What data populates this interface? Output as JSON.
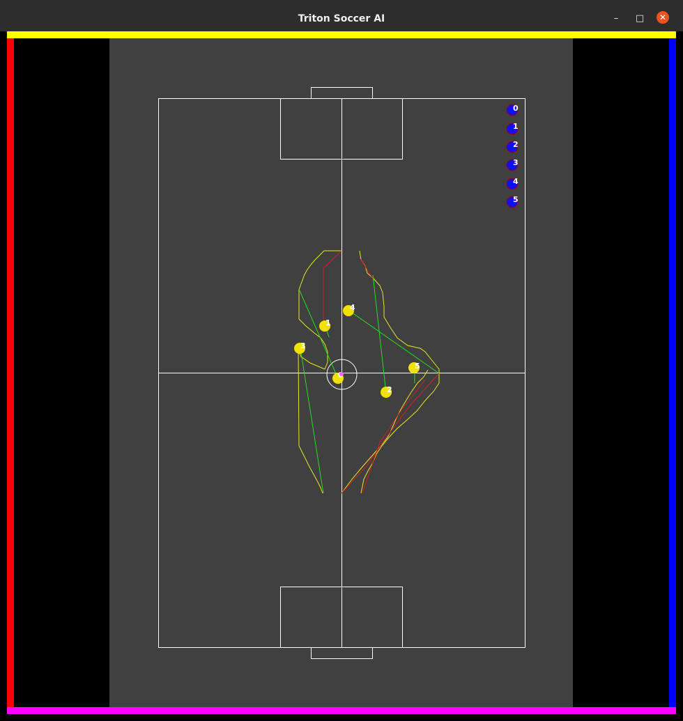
{
  "window": {
    "title": "Triton Soccer AI",
    "controls": {
      "minimize": "–",
      "maximize": "□",
      "close": "✕"
    }
  },
  "colors": {
    "titlebar": "#2d2d2d",
    "border_top": "#ffff00",
    "border_left": "#ff0000",
    "border_right": "#0000ff",
    "border_bottom": "#ff00ff",
    "field": "#404040",
    "lines": "#ffffff",
    "yellow_team": "#f2e200",
    "blue_team": "#1010ee",
    "path_green": "#22dd22",
    "path_red": "#cc2222",
    "contour_yellow": "#e8e820"
  },
  "blue_robots": [
    {
      "id": "0"
    },
    {
      "id": "1"
    },
    {
      "id": "2"
    },
    {
      "id": "3"
    },
    {
      "id": "4"
    },
    {
      "id": "5"
    }
  ],
  "yellow_robots": [
    {
      "id": "0"
    },
    {
      "id": "1"
    },
    {
      "id": "2"
    },
    {
      "id": "3"
    },
    {
      "id": "4"
    },
    {
      "id": "5"
    }
  ]
}
